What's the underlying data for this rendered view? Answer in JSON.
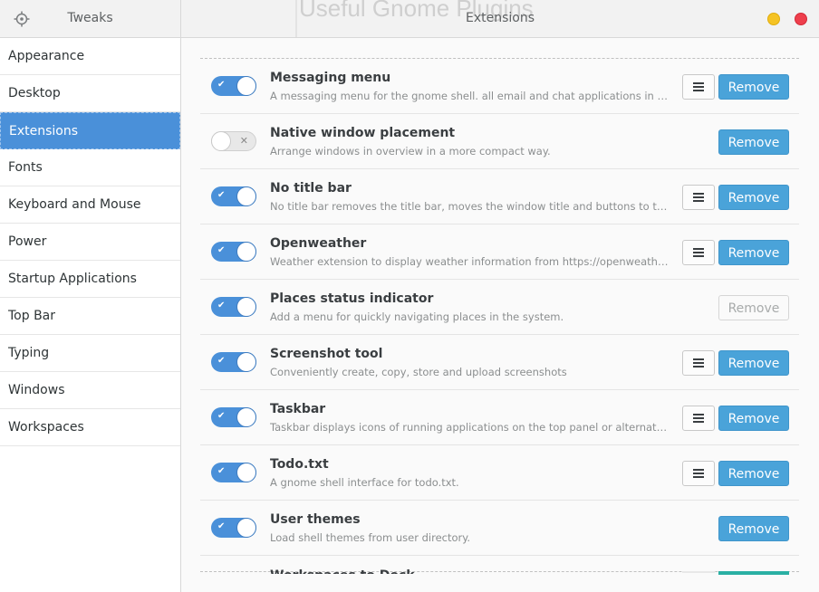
{
  "window": {
    "left_title": "Tweaks",
    "right_title": "Extensions",
    "background_ghost_text": "Useful Gnome Plugins"
  },
  "colors": {
    "accent": "#4a90d9",
    "remove": "#4aa3d9",
    "minimize": "#f5c324",
    "close": "#ee3f4c"
  },
  "sidebar": {
    "items": [
      {
        "label": "Appearance"
      },
      {
        "label": "Desktop"
      },
      {
        "label": "Extensions",
        "selected": true
      },
      {
        "label": "Fonts"
      },
      {
        "label": "Keyboard and Mouse"
      },
      {
        "label": "Power"
      },
      {
        "label": "Startup Applications"
      },
      {
        "label": "Top Bar"
      },
      {
        "label": "Typing"
      },
      {
        "label": "Windows"
      },
      {
        "label": "Workspaces"
      }
    ]
  },
  "extensions": [
    {
      "name": "Messaging menu",
      "description": "A messaging menu for the gnome shell. all email and chat applications in one pla...",
      "enabled": true,
      "has_settings": true,
      "remove_label": "Remove",
      "remove_enabled": true
    },
    {
      "name": "Native window placement",
      "description": "Arrange windows in overview in a more compact way.",
      "enabled": false,
      "has_settings": false,
      "remove_label": "Remove",
      "remove_enabled": true
    },
    {
      "name": "No title bar",
      "description": "No title bar removes the title bar, moves the window title and buttons to the top ...",
      "enabled": true,
      "has_settings": true,
      "remove_label": "Remove",
      "remove_enabled": true
    },
    {
      "name": "Openweather",
      "description": "Weather extension to display weather information from https://openweatherma...",
      "enabled": true,
      "has_settings": true,
      "remove_label": "Remove",
      "remove_enabled": true
    },
    {
      "name": "Places status indicator",
      "description": "Add a menu for quickly navigating places in the system.",
      "enabled": true,
      "has_settings": false,
      "remove_label": "Remove",
      "remove_enabled": false
    },
    {
      "name": "Screenshot tool",
      "description": "Conveniently create, copy, store and upload screenshots",
      "enabled": true,
      "has_settings": true,
      "remove_label": "Remove",
      "remove_enabled": true
    },
    {
      "name": "Taskbar",
      "description": "Taskbar displays icons of running applications on the top panel or alternatively ...",
      "enabled": true,
      "has_settings": true,
      "remove_label": "Remove",
      "remove_enabled": true
    },
    {
      "name": "Todo.txt",
      "description": "A gnome shell interface for todo.txt.",
      "enabled": true,
      "has_settings": true,
      "remove_label": "Remove",
      "remove_enabled": true
    },
    {
      "name": "User themes",
      "description": "Load shell themes from user directory.",
      "enabled": true,
      "has_settings": false,
      "remove_label": "Remove",
      "remove_enabled": true
    }
  ],
  "toggle_icons": {
    "on": "checkmark-icon",
    "off": "x-icon"
  },
  "peek_row_name": "Workspaces to Dock"
}
